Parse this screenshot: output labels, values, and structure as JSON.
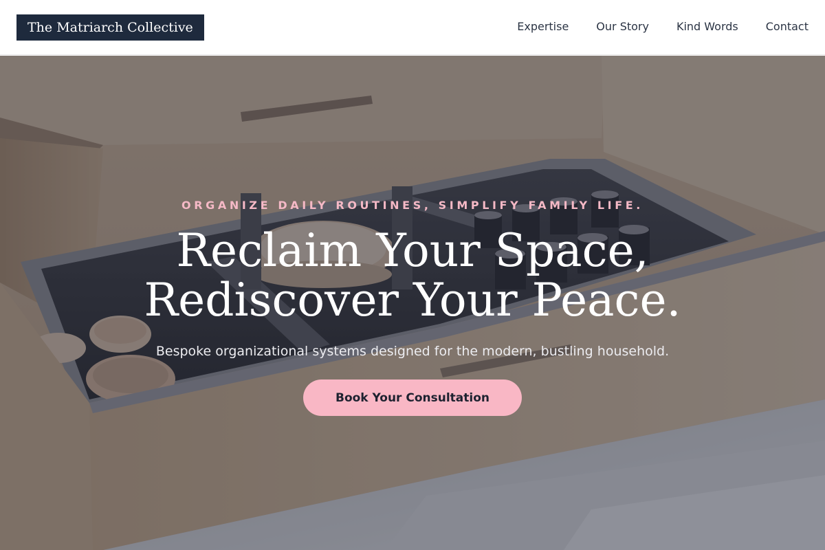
{
  "brand": {
    "name": "The Matriarch Collective"
  },
  "nav": {
    "items": [
      {
        "label": "Expertise"
      },
      {
        "label": "Our Story"
      },
      {
        "label": "Kind Words"
      },
      {
        "label": "Contact"
      }
    ]
  },
  "hero": {
    "eyebrow": "ORGANIZE DAILY ROUTINES, SIMPLIFY FAMILY LIFE.",
    "headline_line1": "Reclaim Your Space,",
    "headline_line2": "Rediscover Your Peace.",
    "subheading": "Bespoke organizational systems designed for the modern, bustling household.",
    "cta_label": "Book Your Consultation",
    "background_image": "kitchen-drawer-organizer-photo"
  },
  "colors": {
    "brand_navy": "#1e2a3d",
    "accent_pink": "#f9b7c5",
    "eyebrow_pink": "#f5b9c6",
    "nav_text": "#2b3444"
  }
}
